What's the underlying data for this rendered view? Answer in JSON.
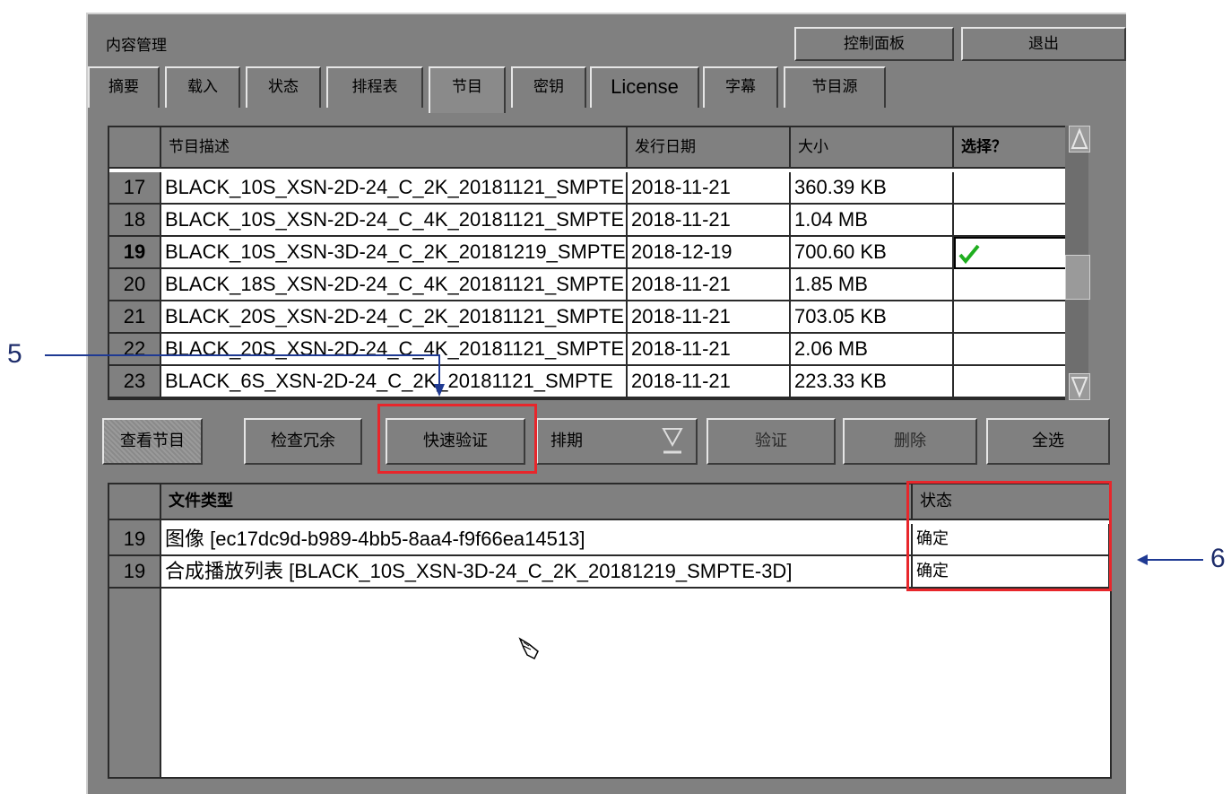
{
  "header": {
    "title": "内容管理",
    "control_panel_label": "控制面板",
    "exit_label": "退出"
  },
  "tabs": [
    {
      "label": "摘要"
    },
    {
      "label": "载入"
    },
    {
      "label": "状态"
    },
    {
      "label": "排程表"
    },
    {
      "label": "节目",
      "active": true
    },
    {
      "label": "密钥"
    },
    {
      "label": "License"
    },
    {
      "label": "字幕"
    },
    {
      "label": "节目源"
    }
  ],
  "program_table": {
    "columns": [
      "节目描述",
      "发行日期",
      "大小",
      "选择？"
    ],
    "rows": [
      {
        "num": "17",
        "desc": "BLACK_10S_XSN-2D-24_C_2K_20181121_SMPTE",
        "date": "2018-11-21",
        "size": "360.39 KB",
        "selected": false
      },
      {
        "num": "18",
        "desc": "BLACK_10S_XSN-2D-24_C_4K_20181121_SMPTE",
        "date": "2018-11-21",
        "size": "1.04 MB",
        "selected": false
      },
      {
        "num": "19",
        "desc": "BLACK_10S_XSN-3D-24_C_2K_20181219_SMPTE",
        "date": "2018-12-19",
        "size": "700.60 KB",
        "selected": true
      },
      {
        "num": "20",
        "desc": "BLACK_18S_XSN-2D-24_C_4K_20181121_SMPTE",
        "date": "2018-11-21",
        "size": "1.85 MB",
        "selected": false
      },
      {
        "num": "21",
        "desc": "BLACK_20S_XSN-2D-24_C_2K_20181121_SMPTE",
        "date": "2018-11-21",
        "size": "703.05 KB",
        "selected": false
      },
      {
        "num": "22",
        "desc": "BLACK_20S_XSN-2D-24_C_4K_20181121_SMPTE",
        "date": "2018-11-21",
        "size": "2.06 MB",
        "selected": false
      },
      {
        "num": "23",
        "desc": "BLACK_6S_XSN-2D-24_C_2K_20181121_SMPTE",
        "date": "2018-11-21",
        "size": "223.33 KB",
        "selected": false
      }
    ]
  },
  "buttons": {
    "view_program": "查看节目",
    "check_redundancy": "检查冗余",
    "quick_verify": "快速验证",
    "schedule": "排期",
    "verify": "验证",
    "delete": "删除",
    "select_all": "全选"
  },
  "file_table": {
    "columns": [
      "文件类型",
      "状态"
    ],
    "rows": [
      {
        "num": "19",
        "type": "图像 [ec17dc9d-b989-4bb5-8aa4-f9f66ea14513]",
        "status": "确定"
      },
      {
        "num": "19",
        "type": "合成播放列表 [BLACK_10S_XSN-3D-24_C_2K_20181219_SMPTE-3D]",
        "status": "确定"
      }
    ]
  },
  "annotations": {
    "label_5": "5",
    "label_6": "6",
    "highlight_color": "#e8262b",
    "arrow_color": "#1f3a93"
  }
}
